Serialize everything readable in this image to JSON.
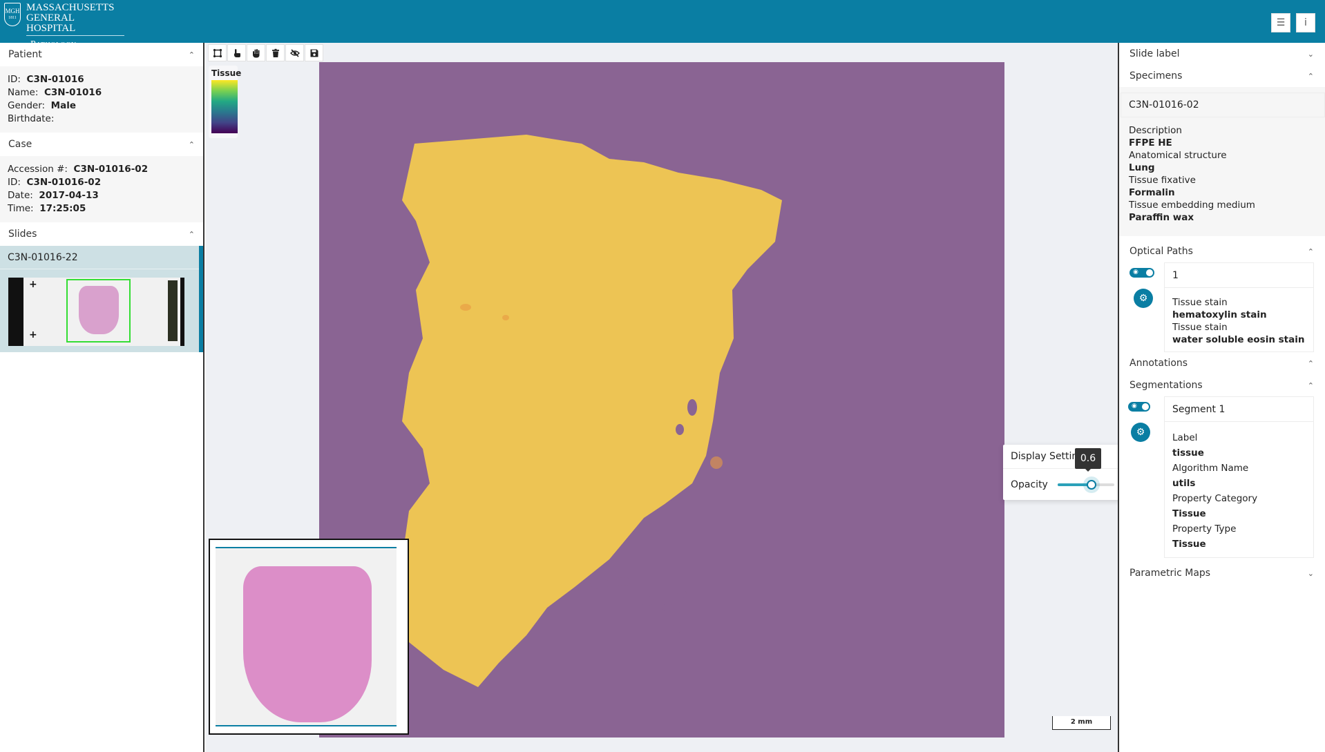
{
  "header": {
    "logo": {
      "shield_text": "MGH",
      "shield_year": "1811",
      "line1": "MASSACHUSETTS",
      "line2": "GENERAL HOSPITAL",
      "department": "Pathology"
    },
    "buttons": [
      {
        "name": "list-button",
        "icon": "list-icon",
        "glyph": "☰"
      },
      {
        "name": "info-button",
        "icon": "info-icon",
        "glyph": "i"
      }
    ]
  },
  "left_panel": {
    "patient": {
      "title": "Patient",
      "fields": [
        {
          "label": "ID",
          "value": "C3N-01016"
        },
        {
          "label": "Name",
          "value": "C3N-01016"
        },
        {
          "label": "Gender",
          "value": "Male"
        },
        {
          "label": "Birthdate",
          "value": ""
        }
      ]
    },
    "case": {
      "title": "Case",
      "fields": [
        {
          "label": "Accession #",
          "value": "C3N-01016-02"
        },
        {
          "label": "ID",
          "value": "C3N-01016-02"
        },
        {
          "label": "Date",
          "value": "2017-04-13"
        },
        {
          "label": "Time",
          "value": "17:25:05"
        }
      ]
    },
    "slides": {
      "title": "Slides",
      "items": [
        {
          "label": "C3N-01016-22",
          "selected": true
        }
      ]
    }
  },
  "viewer": {
    "toolbar": [
      {
        "name": "draw-roi-tool",
        "icon": "draw-roi-icon"
      },
      {
        "name": "modify-tool",
        "icon": "pointer-hand-icon"
      },
      {
        "name": "pan-tool",
        "icon": "hand-icon"
      },
      {
        "name": "delete-tool",
        "icon": "trash-icon"
      },
      {
        "name": "hide-tool",
        "icon": "eye-slash-icon"
      },
      {
        "name": "save-tool",
        "icon": "save-icon"
      }
    ],
    "legend": {
      "title": "Tissue",
      "colormap": [
        "#fde725",
        "#7ad151",
        "#22a884",
        "#2a788e",
        "#414487",
        "#440154"
      ]
    },
    "scale_bar": "2 mm",
    "display_settings": {
      "title": "Display Settings",
      "opacity_label": "Opacity",
      "opacity_value": 0.6,
      "tooltip": "0.6"
    }
  },
  "right_panel": {
    "slide_label": {
      "title": "Slide label"
    },
    "specimens": {
      "title": "Specimens",
      "items": [
        {
          "id": "C3N-01016-02",
          "fields": [
            {
              "label": "Description",
              "value": "FFPE HE"
            },
            {
              "label": "Anatomical structure",
              "value": "Lung"
            },
            {
              "label": "Tissue fixative",
              "value": "Formalin"
            },
            {
              "label": "Tissue embedding medium",
              "value": "Paraffin wax"
            }
          ]
        }
      ]
    },
    "optical_paths": {
      "title": "Optical Paths",
      "items": [
        {
          "id": "1",
          "visible": true,
          "fields": [
            {
              "label": "Tissue stain",
              "value": "hematoxylin stain"
            },
            {
              "label": "Tissue stain",
              "value": "water soluble eosin stain"
            }
          ]
        }
      ]
    },
    "annotations": {
      "title": "Annotations"
    },
    "segmentations": {
      "title": "Segmentations",
      "items": [
        {
          "id": "Segment 1",
          "visible": true,
          "fields": [
            {
              "label": "Label",
              "value": "tissue"
            },
            {
              "label": "Algorithm Name",
              "value": "utils"
            },
            {
              "label": "Property Category",
              "value": "Tissue"
            },
            {
              "label": "Property Type",
              "value": "Tissue"
            }
          ]
        }
      ]
    },
    "parametric_maps": {
      "title": "Parametric Maps"
    }
  },
  "colors": {
    "brand": "#0a7ea3",
    "slide_background": "#8a6493",
    "segment_fill": "#f2c950"
  }
}
